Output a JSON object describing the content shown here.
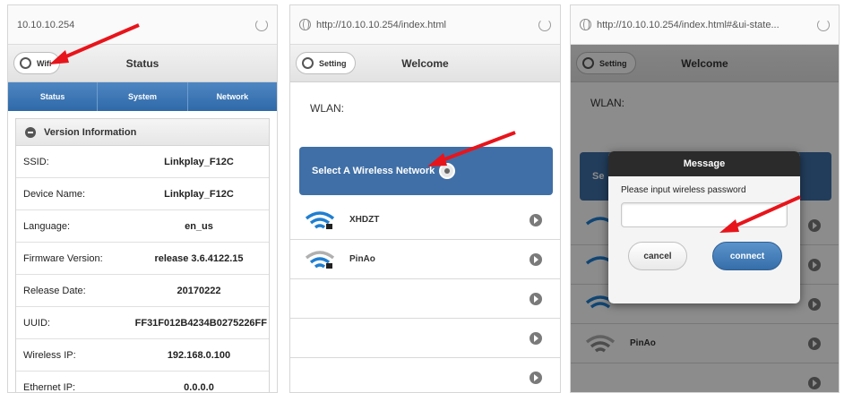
{
  "panel1": {
    "url": "10.10.10.254",
    "header_button": "Wifi",
    "title": "Status",
    "tabs": [
      "Status",
      "System",
      "Network"
    ],
    "section_title": "Version Information",
    "rows": [
      {
        "label": "SSID:",
        "value": "Linkplay_F12C"
      },
      {
        "label": "Device Name:",
        "value": "Linkplay_F12C"
      },
      {
        "label": "Language:",
        "value": "en_us"
      },
      {
        "label": "Firmware Version:",
        "value": "release 3.6.4122.15"
      },
      {
        "label": "Release Date:",
        "value": "20170222"
      },
      {
        "label": "UUID:",
        "value": "FF31F012B4234B0275226FF"
      },
      {
        "label": "Wireless IP:",
        "value": "192.168.0.100"
      },
      {
        "label": "Ethernet IP:",
        "value": "0.0.0.0"
      }
    ]
  },
  "panel2": {
    "url": "http://10.10.10.254/index.html",
    "header_button": "Setting",
    "title": "Welcome",
    "wlan_label": "WLAN:",
    "select_label": "Select A Wireless Network",
    "networks": [
      "XHDZT",
      "PinAo",
      "",
      "",
      ""
    ]
  },
  "panel3": {
    "url": "http://10.10.10.254/index.html#&ui-state...",
    "header_button": "Setting",
    "title": "Welcome",
    "wlan_label": "WLAN:",
    "select_partial": "Se",
    "networks": [
      "",
      "",
      "",
      "PinAo",
      ""
    ],
    "dialog": {
      "title": "Message",
      "prompt": "Please input wireless password",
      "cancel": "cancel",
      "connect": "connect"
    }
  },
  "colors": {
    "accent_blue": "#3f6fa6",
    "arrow_red": "#e8141b",
    "wifi_blue": "#1e7fd1",
    "wifi_gray": "#8a8a8a"
  },
  "icons": [
    "reload-icon",
    "globe-icon",
    "radio-icon",
    "minus-icon",
    "info-icon",
    "wifi-icon",
    "lock-icon",
    "chevron-right-icon",
    "annotation-arrow"
  ]
}
